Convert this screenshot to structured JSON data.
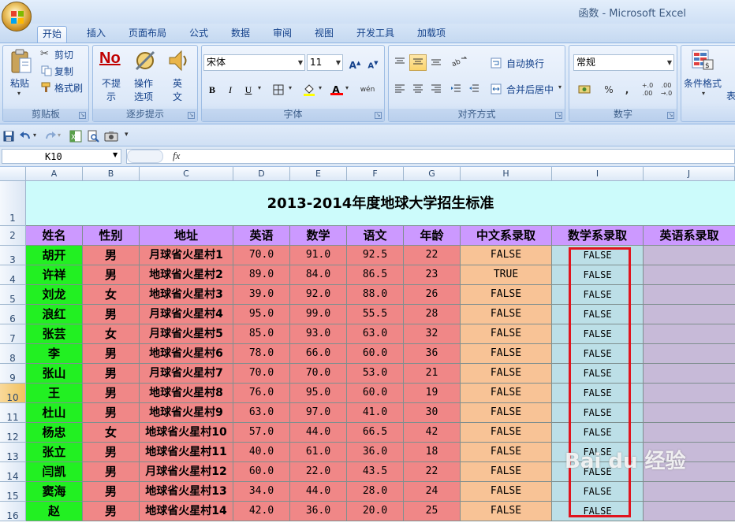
{
  "window": {
    "title": "函数 - Microsoft Excel"
  },
  "tabs": [
    "开始",
    "插入",
    "页面布局",
    "公式",
    "数据",
    "审阅",
    "视图",
    "开发工具",
    "加载项"
  ],
  "ribbon": {
    "clipboard": {
      "label": "剪贴板",
      "paste": "粘贴",
      "cut": "剪切",
      "copy": "复制",
      "format_painter": "格式刷"
    },
    "stepper": {
      "label": "逐步提示",
      "no_prompt": [
        "不提",
        "示"
      ],
      "op_options": [
        "操作",
        "选项"
      ],
      "english": [
        "英",
        "文"
      ]
    },
    "font": {
      "label": "字体",
      "name": "宋体",
      "size": "11",
      "grow": "A",
      "shrink": "A",
      "bold": "B",
      "italic": "I",
      "underline": "U",
      "font_color": "A",
      "phonetic": "wén"
    },
    "alignment": {
      "label": "对齐方式",
      "wrap_text": "自动换行",
      "merge_center": "合并后居中"
    },
    "number": {
      "label": "数字",
      "format": "常规",
      "percent": "%",
      "comma": ",",
      "inc_decimal": "+.0 .00",
      "dec_decimal": ".00 →.0"
    },
    "styles": {
      "conditional": "条件格式",
      "table_partial": "表"
    }
  },
  "formula_bar": {
    "name_box": "K10",
    "fx": "fx",
    "formula": ""
  },
  "sheet": {
    "columns": [
      "A",
      "B",
      "C",
      "D",
      "E",
      "F",
      "G",
      "H",
      "I",
      "J"
    ],
    "title": "2013-2014年度地球大学招生标准",
    "headers": [
      "姓名",
      "性别",
      "地址",
      "英语",
      "数学",
      "语文",
      "年龄",
      "中文系录取",
      "数学系录取",
      "英语系录取"
    ],
    "rows": [
      [
        "胡开",
        "男",
        "月球省火星村1",
        "70.0",
        "91.0",
        "92.5",
        "22",
        "FALSE",
        "FALSE",
        ""
      ],
      [
        "许祥",
        "男",
        "地球省火星村2",
        "89.0",
        "84.0",
        "86.5",
        "23",
        "TRUE",
        "FALSE",
        ""
      ],
      [
        "刘龙",
        "女",
        "地球省火星村3",
        "39.0",
        "92.0",
        "88.0",
        "26",
        "FALSE",
        "FALSE",
        ""
      ],
      [
        "浪红",
        "男",
        "月球省火星村4",
        "95.0",
        "99.0",
        "55.5",
        "28",
        "FALSE",
        "FALSE",
        ""
      ],
      [
        "张芸",
        "女",
        "月球省火星村5",
        "85.0",
        "93.0",
        "63.0",
        "32",
        "FALSE",
        "FALSE",
        ""
      ],
      [
        "李",
        "男",
        "地球省火星村6",
        "78.0",
        "66.0",
        "60.0",
        "36",
        "FALSE",
        "FALSE",
        ""
      ],
      [
        "张山",
        "男",
        "月球省火星村7",
        "70.0",
        "70.0",
        "53.0",
        "21",
        "FALSE",
        "FALSE",
        ""
      ],
      [
        "王",
        "男",
        "地球省火星村8",
        "76.0",
        "95.0",
        "60.0",
        "19",
        "FALSE",
        "FALSE",
        ""
      ],
      [
        "杜山",
        "男",
        "地球省火星村9",
        "63.0",
        "97.0",
        "41.0",
        "30",
        "FALSE",
        "FALSE",
        ""
      ],
      [
        "杨忠",
        "女",
        "地球省火星村10",
        "57.0",
        "44.0",
        "66.5",
        "42",
        "FALSE",
        "FALSE",
        ""
      ],
      [
        "张立",
        "男",
        "地球省火星村11",
        "40.0",
        "61.0",
        "36.0",
        "18",
        "FALSE",
        "FALSE",
        ""
      ],
      [
        "闫凯",
        "男",
        "月球省火星村12",
        "60.0",
        "22.0",
        "43.5",
        "22",
        "FALSE",
        "FALSE",
        ""
      ],
      [
        "窦海",
        "男",
        "地球省火星村13",
        "34.0",
        "44.0",
        "28.0",
        "24",
        "FALSE",
        "FALSE",
        ""
      ],
      [
        "赵",
        "男",
        "地球省火星村14",
        "42.0",
        "36.0",
        "20.0",
        "25",
        "FALSE",
        "FALSE",
        ""
      ]
    ]
  },
  "watermark": "Bai du 经验"
}
